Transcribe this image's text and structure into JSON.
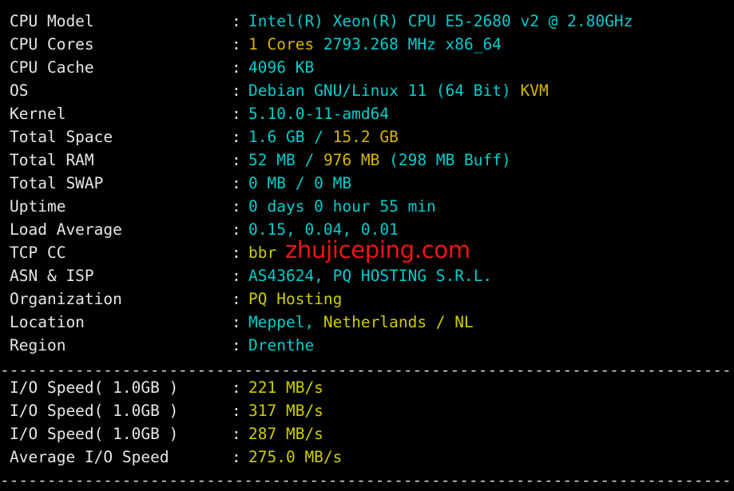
{
  "terminal": {
    "background": "#000000",
    "separator_line": "----------------------------------------------------------------------",
    "colors": {
      "label": "#e6e6e6",
      "cyan": "#00cdcd",
      "yellow": "#cdcd00",
      "gold": "#d8b500",
      "watermark_red": "#f01414"
    }
  },
  "watermark": {
    "text": "zhujiceping.com",
    "color": "#f01414"
  },
  "separator": "---------------------------------------------------------------------------------",
  "colon": ":",
  "system_info": [
    {
      "label": "CPU Model",
      "parts": [
        {
          "text": "Intel(R) Xeon(R) CPU E5-2680 v2 @ 2.80GHz",
          "color": "cyan"
        }
      ]
    },
    {
      "label": "CPU Cores",
      "parts": [
        {
          "text": "1 Cores ",
          "color": "gold"
        },
        {
          "text": "2793.268 MHz x86_64",
          "color": "cyan"
        }
      ]
    },
    {
      "label": "CPU Cache",
      "parts": [
        {
          "text": "4096 KB",
          "color": "cyan"
        }
      ]
    },
    {
      "label": "OS",
      "parts": [
        {
          "text": "Debian GNU/Linux 11 (64 Bit) ",
          "color": "cyan"
        },
        {
          "text": "KVM",
          "color": "gold"
        }
      ]
    },
    {
      "label": "Kernel",
      "parts": [
        {
          "text": "5.10.0-11-amd64",
          "color": "cyan"
        }
      ]
    },
    {
      "label": "Total Space",
      "parts": [
        {
          "text": "1.6 GB ",
          "color": "cyan"
        },
        {
          "text": "/ ",
          "color": "cyan"
        },
        {
          "text": "15.2 GB",
          "color": "gold"
        }
      ]
    },
    {
      "label": "Total RAM",
      "parts": [
        {
          "text": "52 MB ",
          "color": "cyan"
        },
        {
          "text": "/ ",
          "color": "cyan"
        },
        {
          "text": "976 MB ",
          "color": "gold"
        },
        {
          "text": "(298 MB Buff)",
          "color": "cyan"
        }
      ]
    },
    {
      "label": "Total SWAP",
      "parts": [
        {
          "text": "0 MB / 0 MB",
          "color": "cyan"
        }
      ]
    },
    {
      "label": "Uptime",
      "parts": [
        {
          "text": "0 days 0 hour 55 min",
          "color": "cyan"
        }
      ]
    },
    {
      "label": "Load Average",
      "parts": [
        {
          "text": "0.15, 0.04, 0.01",
          "color": "cyan"
        }
      ]
    },
    {
      "label": "TCP CC",
      "parts": [
        {
          "text": "bbr",
          "color": "yellow"
        }
      ]
    },
    {
      "label": "ASN & ISP",
      "parts": [
        {
          "text": "AS43624, PQ HOSTING S.R.L.",
          "color": "cyan"
        }
      ]
    },
    {
      "label": "Organization",
      "parts": [
        {
          "text": "PQ Hosting",
          "color": "yellow"
        }
      ]
    },
    {
      "label": "Location",
      "parts": [
        {
          "text": "Meppel, ",
          "color": "cyan"
        },
        {
          "text": "Netherlands / NL",
          "color": "yellow"
        }
      ]
    },
    {
      "label": "Region",
      "parts": [
        {
          "text": "Drenthe",
          "color": "cyan"
        }
      ]
    }
  ],
  "io_results": [
    {
      "label": "I/O Speed( 1.0GB )",
      "parts": [
        {
          "text": "221 MB/s",
          "color": "yellow"
        }
      ]
    },
    {
      "label": "I/O Speed( 1.0GB )",
      "parts": [
        {
          "text": "317 MB/s",
          "color": "yellow"
        }
      ]
    },
    {
      "label": "I/O Speed( 1.0GB )",
      "parts": [
        {
          "text": "287 MB/s",
          "color": "yellow"
        }
      ]
    },
    {
      "label": "Average I/O Speed",
      "parts": [
        {
          "text": "275.0 MB/s",
          "color": "yellow"
        }
      ]
    }
  ]
}
